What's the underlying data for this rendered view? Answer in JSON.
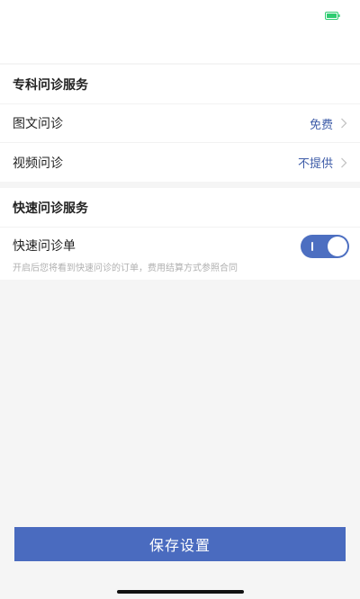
{
  "colors": {
    "accent": "#4d6fc1",
    "button": "#4a6bbf",
    "value_text": "#3e5ca8",
    "battery": "#2ecc71"
  },
  "specialist": {
    "title": "专科问诊服务",
    "items": [
      {
        "label": "图文问诊",
        "value": "免费",
        "icon": "chevron-right-icon"
      },
      {
        "label": "视频问诊",
        "value": "不提供",
        "icon": "chevron-right-icon"
      }
    ]
  },
  "quick": {
    "title": "快速问诊服务",
    "order_label": "快速问诊单",
    "description": "开启后您将看到快速问诊的订单，费用结算方式参照合同",
    "toggle_on": true
  },
  "actions": {
    "save_label": "保存设置"
  }
}
